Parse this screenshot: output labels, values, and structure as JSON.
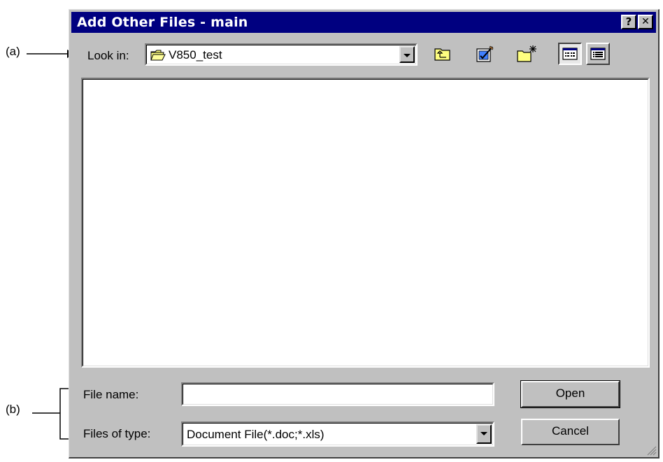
{
  "annotations": {
    "a": "(a)",
    "b": "(b)"
  },
  "window": {
    "title": "Add Other Files - main",
    "help_button": "?",
    "close_button": "✕"
  },
  "look_in": {
    "label": "Look in:",
    "value": "V850_test",
    "icon": "folder-icon"
  },
  "toolbar": {
    "buttons": [
      {
        "name": "up-one-level",
        "icon": "folder-up-icon"
      },
      {
        "name": "desktop",
        "icon": "desktop-icon"
      },
      {
        "name": "new-folder",
        "icon": "new-folder-icon"
      },
      {
        "name": "list-view",
        "icon": "list-view-icon",
        "pressed": true
      },
      {
        "name": "details-view",
        "icon": "details-view-icon"
      }
    ]
  },
  "file_list": {
    "items": []
  },
  "file_name": {
    "label": "File name:",
    "value": ""
  },
  "files_of_type": {
    "label": "Files of type:",
    "value": "Document File(*.doc;*.xls)"
  },
  "buttons": {
    "open": "Open",
    "cancel": "Cancel"
  },
  "colors": {
    "titlebar": "#000080",
    "face": "#c0c0c0",
    "highlight": "#ffffff",
    "shadow": "#808080"
  }
}
